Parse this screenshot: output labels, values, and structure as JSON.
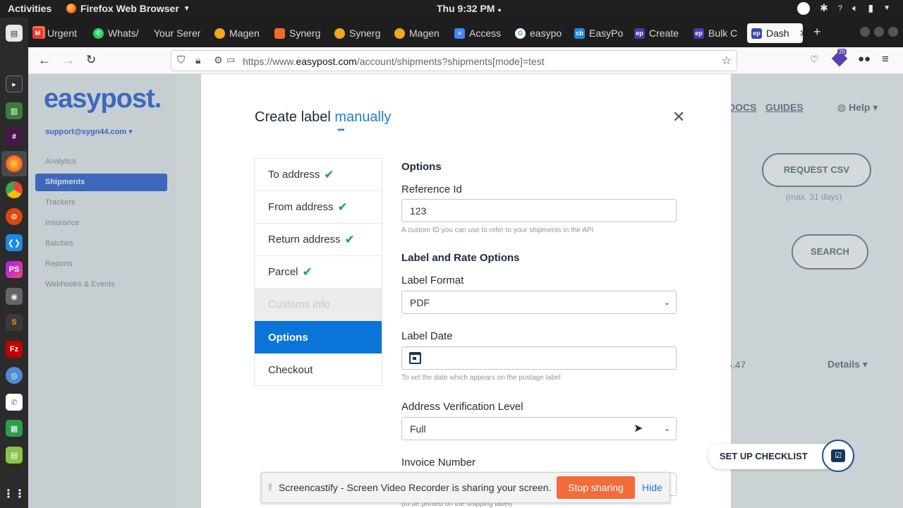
{
  "system": {
    "activities": "Activities",
    "app_name": "Firefox Web Browser",
    "clock": "Thu  9:32 PM"
  },
  "browser": {
    "tabs": [
      {
        "label": "Urgent",
        "color": "#e53935",
        "icon": "gmail-icon"
      },
      {
        "label": "Whats/",
        "color": "#25d366",
        "icon": "whatsapp-icon"
      },
      {
        "label": "Your Serer",
        "color": "#555555",
        "icon": "page-icon"
      },
      {
        "label": "Magen",
        "color": "#f5a623",
        "icon": "magento-icon"
      },
      {
        "label": "Synerg",
        "color": "#ee6b2b",
        "icon": "magento-icon"
      },
      {
        "label": "Synerg",
        "color": "#f5a623",
        "icon": "magento-icon"
      },
      {
        "label": "Magen",
        "color": "#f5a623",
        "icon": "magento-icon"
      },
      {
        "label": "Access",
        "color": "#4285f4",
        "icon": "docs-icon"
      },
      {
        "label": "easypo",
        "color": "#ffffff",
        "icon": "google-icon"
      },
      {
        "label": "EasyPo",
        "color": "#1e88e5",
        "icon": "cb-icon"
      },
      {
        "label": "Create",
        "color": "#4a3aa8",
        "icon": "easypost-icon"
      },
      {
        "label": "Bulk C",
        "color": "#4a3aa8",
        "icon": "easypost-icon"
      },
      {
        "label": "Dash",
        "color": "#3949ab",
        "icon": "easypost-icon"
      }
    ],
    "url_prefix": "https://www.",
    "url_domain": "easypost.com",
    "url_path": "/account/shipments?shipments[mode]=test",
    "badge_count": "20"
  },
  "app": {
    "logo": "easypost.",
    "account": "support@sygn44.com ▾",
    "sidebar": [
      "Analytics",
      "Shipments",
      "Trackers",
      "Insurance",
      "Batches",
      "Reports",
      "Webhooks & Events"
    ],
    "header_links": {
      "docs": "DOCS",
      "guides": "GUIDES",
      "help": "Help"
    },
    "request_csv": "REQUEST CSV",
    "csv_note": "(max. 31 days)",
    "search": "SEARCH",
    "row_value": "5.47",
    "row_details": "Details",
    "checklist": "SET UP CHECKLIST",
    "brand_color": "#3f6fd8"
  },
  "modal": {
    "title_plain": "Create label",
    "title_accent": "manually",
    "nav": [
      {
        "label": "To address",
        "done": true
      },
      {
        "label": "From address",
        "done": true
      },
      {
        "label": "Return address",
        "done": true
      },
      {
        "label": "Parcel",
        "done": true
      },
      {
        "label": "Customs info",
        "done": false
      },
      {
        "label": "Options",
        "done": false
      },
      {
        "label": "Checkout",
        "done": false
      }
    ],
    "active_nav": "Options",
    "options_heading": "Options",
    "reference_label": "Reference Id",
    "reference_value": "123",
    "reference_help": "A custom ID you can use to refer to your shipments in the API",
    "label_rate_heading": "Label and Rate Options",
    "label_format_label": "Label Format",
    "label_format_value": "PDF",
    "label_date_label": "Label Date",
    "label_date_help": "To set the date which appears on the postage label",
    "address_verification_label": "Address Verification Level",
    "address_verification_value": "Full",
    "invoice_label": "Invoice Number",
    "invoice_help": "(to be printed on the shipping label)"
  },
  "screencastify": {
    "message": "Screencastify - Screen Video Recorder is sharing your screen.",
    "stop": "Stop sharing",
    "hide": "Hide"
  }
}
